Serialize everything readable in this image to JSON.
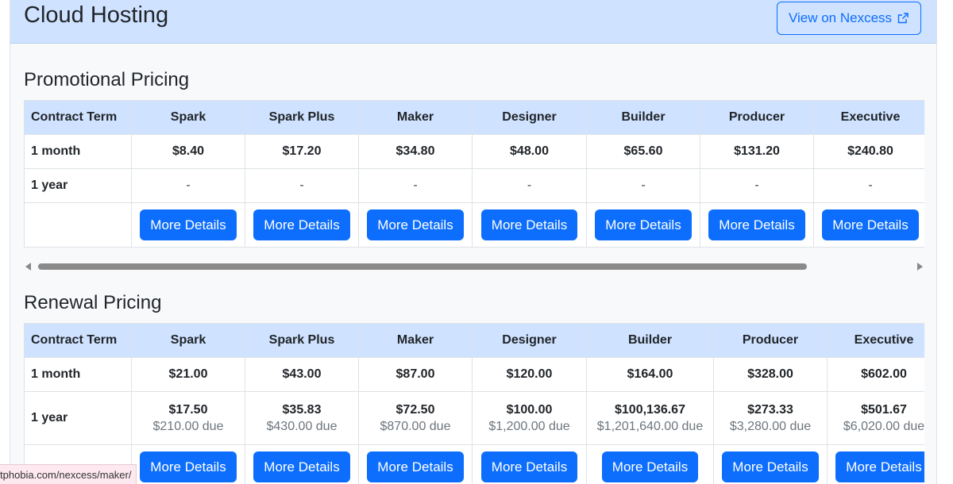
{
  "header": {
    "title": "Cloud Hosting",
    "view_button_label": "View on Nexcess",
    "external_icon": "external-link-icon"
  },
  "promotional": {
    "title": "Promotional Pricing",
    "term_header": "Contract Term",
    "plans": [
      "Spark",
      "Spark Plus",
      "Maker",
      "Designer",
      "Builder",
      "Producer",
      "Executive"
    ],
    "rows": [
      {
        "term": "1 month",
        "prices": [
          "$8.40",
          "$17.20",
          "$34.80",
          "$48.00",
          "$65.60",
          "$131.20",
          "$240.80"
        ]
      },
      {
        "term": "1 year",
        "prices": [
          "-",
          "-",
          "-",
          "-",
          "-",
          "-",
          "-"
        ]
      }
    ],
    "button_label": "More Details"
  },
  "renewal": {
    "title": "Renewal Pricing",
    "term_header": "Contract Term",
    "plans": [
      "Spark",
      "Spark Plus",
      "Maker",
      "Designer",
      "Builder",
      "Producer",
      "Executive"
    ],
    "rows": [
      {
        "term": "1 month",
        "prices": [
          "$21.00",
          "$43.00",
          "$87.00",
          "$120.00",
          "$164.00",
          "$328.00",
          "$602.00"
        ]
      },
      {
        "term": "1 year",
        "prices": [
          "$17.50",
          "$35.83",
          "$72.50",
          "$100.00",
          "$100,136.67",
          "$273.33",
          "$501.67"
        ],
        "due": [
          "$210.00 due",
          "$430.00 due",
          "$870.00 due",
          "$1,200.00 due",
          "$1,201,640.00 due",
          "$3,280.00 due",
          "$6,020.00 due"
        ]
      }
    ],
    "button_label": "More Details"
  },
  "status_bar": {
    "url": "tphobia.com/nexcess/maker/"
  },
  "colors": {
    "primary": "#0d6efd",
    "header_bg": "#cfe2ff"
  }
}
